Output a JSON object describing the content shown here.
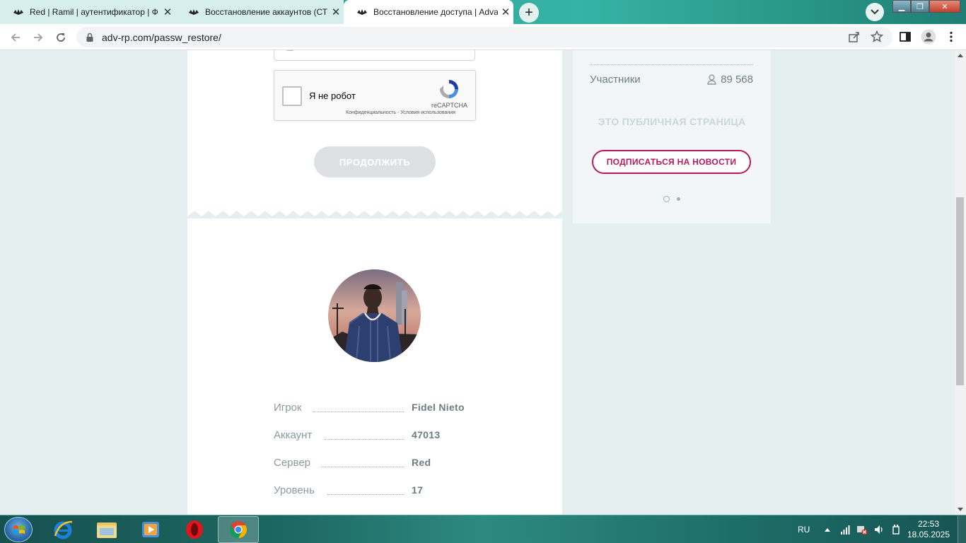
{
  "browser": {
    "tabs": [
      {
        "title": "Red | Ramil | аутентификатор | Ф",
        "active": false
      },
      {
        "title": "Восстановление аккаунтов (СТР",
        "active": false
      },
      {
        "title": "Восстановление доступа | Adva",
        "active": true
      }
    ],
    "new_tab_symbol": "+",
    "close_symbol": "✕",
    "url_host": "adv-rp.com",
    "url_path": "/passw_restore/",
    "window_controls": {
      "minimize": "▁",
      "maximize": "❐",
      "close": "✕"
    }
  },
  "form": {
    "recaptcha_label": "Я не робот",
    "recaptcha_brand": "reCAPTCHA",
    "recaptcha_terms": "Конфиденциальность - Условия использования",
    "continue_button": "ПРОДОЛЖИТЬ"
  },
  "player": {
    "rows": [
      {
        "label": "Игрок",
        "value": "Fidel  Nieto"
      },
      {
        "label": "Аккаунт",
        "value": "47013"
      },
      {
        "label": "Сервер",
        "value": "Red"
      },
      {
        "label": "Уровень",
        "value": "17"
      }
    ]
  },
  "sidebar": {
    "members_label": "Участники",
    "members_count": "89 568",
    "public_note": "ЭТО ПУБЛИЧНАЯ СТРАНИЦА",
    "subscribe_button": "ПОДПИСАТЬСЯ НА НОВОСТИ",
    "accent_color": "#b8185c"
  },
  "taskbar": {
    "language": "RU",
    "time": "22:53",
    "date": "18.05.2025",
    "apps": [
      "internet-explorer-icon",
      "file-explorer-icon",
      "media-player-icon",
      "opera-icon",
      "chrome-icon"
    ]
  }
}
